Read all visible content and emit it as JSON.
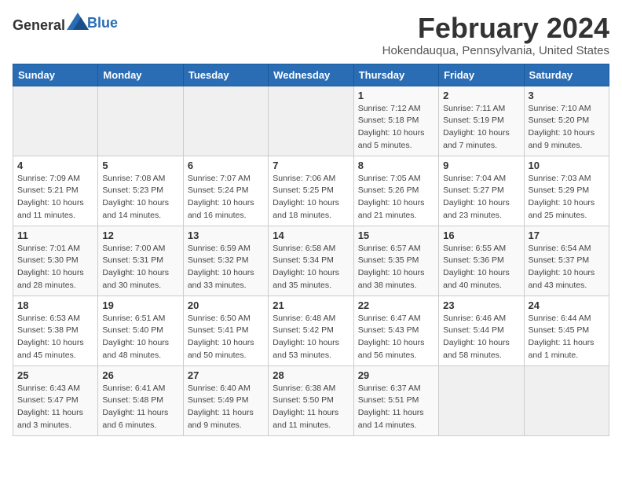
{
  "logo": {
    "text_general": "General",
    "text_blue": "Blue"
  },
  "title": "February 2024",
  "subtitle": "Hokendauqua, Pennsylvania, United States",
  "days_of_week": [
    "Sunday",
    "Monday",
    "Tuesday",
    "Wednesday",
    "Thursday",
    "Friday",
    "Saturday"
  ],
  "weeks": [
    [
      {
        "day": "",
        "info": ""
      },
      {
        "day": "",
        "info": ""
      },
      {
        "day": "",
        "info": ""
      },
      {
        "day": "",
        "info": ""
      },
      {
        "day": "1",
        "info": "Sunrise: 7:12 AM\nSunset: 5:18 PM\nDaylight: 10 hours\nand 5 minutes."
      },
      {
        "day": "2",
        "info": "Sunrise: 7:11 AM\nSunset: 5:19 PM\nDaylight: 10 hours\nand 7 minutes."
      },
      {
        "day": "3",
        "info": "Sunrise: 7:10 AM\nSunset: 5:20 PM\nDaylight: 10 hours\nand 9 minutes."
      }
    ],
    [
      {
        "day": "4",
        "info": "Sunrise: 7:09 AM\nSunset: 5:21 PM\nDaylight: 10 hours\nand 11 minutes."
      },
      {
        "day": "5",
        "info": "Sunrise: 7:08 AM\nSunset: 5:23 PM\nDaylight: 10 hours\nand 14 minutes."
      },
      {
        "day": "6",
        "info": "Sunrise: 7:07 AM\nSunset: 5:24 PM\nDaylight: 10 hours\nand 16 minutes."
      },
      {
        "day": "7",
        "info": "Sunrise: 7:06 AM\nSunset: 5:25 PM\nDaylight: 10 hours\nand 18 minutes."
      },
      {
        "day": "8",
        "info": "Sunrise: 7:05 AM\nSunset: 5:26 PM\nDaylight: 10 hours\nand 21 minutes."
      },
      {
        "day": "9",
        "info": "Sunrise: 7:04 AM\nSunset: 5:27 PM\nDaylight: 10 hours\nand 23 minutes."
      },
      {
        "day": "10",
        "info": "Sunrise: 7:03 AM\nSunset: 5:29 PM\nDaylight: 10 hours\nand 25 minutes."
      }
    ],
    [
      {
        "day": "11",
        "info": "Sunrise: 7:01 AM\nSunset: 5:30 PM\nDaylight: 10 hours\nand 28 minutes."
      },
      {
        "day": "12",
        "info": "Sunrise: 7:00 AM\nSunset: 5:31 PM\nDaylight: 10 hours\nand 30 minutes."
      },
      {
        "day": "13",
        "info": "Sunrise: 6:59 AM\nSunset: 5:32 PM\nDaylight: 10 hours\nand 33 minutes."
      },
      {
        "day": "14",
        "info": "Sunrise: 6:58 AM\nSunset: 5:34 PM\nDaylight: 10 hours\nand 35 minutes."
      },
      {
        "day": "15",
        "info": "Sunrise: 6:57 AM\nSunset: 5:35 PM\nDaylight: 10 hours\nand 38 minutes."
      },
      {
        "day": "16",
        "info": "Sunrise: 6:55 AM\nSunset: 5:36 PM\nDaylight: 10 hours\nand 40 minutes."
      },
      {
        "day": "17",
        "info": "Sunrise: 6:54 AM\nSunset: 5:37 PM\nDaylight: 10 hours\nand 43 minutes."
      }
    ],
    [
      {
        "day": "18",
        "info": "Sunrise: 6:53 AM\nSunset: 5:38 PM\nDaylight: 10 hours\nand 45 minutes."
      },
      {
        "day": "19",
        "info": "Sunrise: 6:51 AM\nSunset: 5:40 PM\nDaylight: 10 hours\nand 48 minutes."
      },
      {
        "day": "20",
        "info": "Sunrise: 6:50 AM\nSunset: 5:41 PM\nDaylight: 10 hours\nand 50 minutes."
      },
      {
        "day": "21",
        "info": "Sunrise: 6:48 AM\nSunset: 5:42 PM\nDaylight: 10 hours\nand 53 minutes."
      },
      {
        "day": "22",
        "info": "Sunrise: 6:47 AM\nSunset: 5:43 PM\nDaylight: 10 hours\nand 56 minutes."
      },
      {
        "day": "23",
        "info": "Sunrise: 6:46 AM\nSunset: 5:44 PM\nDaylight: 10 hours\nand 58 minutes."
      },
      {
        "day": "24",
        "info": "Sunrise: 6:44 AM\nSunset: 5:45 PM\nDaylight: 11 hours\nand 1 minute."
      }
    ],
    [
      {
        "day": "25",
        "info": "Sunrise: 6:43 AM\nSunset: 5:47 PM\nDaylight: 11 hours\nand 3 minutes."
      },
      {
        "day": "26",
        "info": "Sunrise: 6:41 AM\nSunset: 5:48 PM\nDaylight: 11 hours\nand 6 minutes."
      },
      {
        "day": "27",
        "info": "Sunrise: 6:40 AM\nSunset: 5:49 PM\nDaylight: 11 hours\nand 9 minutes."
      },
      {
        "day": "28",
        "info": "Sunrise: 6:38 AM\nSunset: 5:50 PM\nDaylight: 11 hours\nand 11 minutes."
      },
      {
        "day": "29",
        "info": "Sunrise: 6:37 AM\nSunset: 5:51 PM\nDaylight: 11 hours\nand 14 minutes."
      },
      {
        "day": "",
        "info": ""
      },
      {
        "day": "",
        "info": ""
      }
    ]
  ]
}
